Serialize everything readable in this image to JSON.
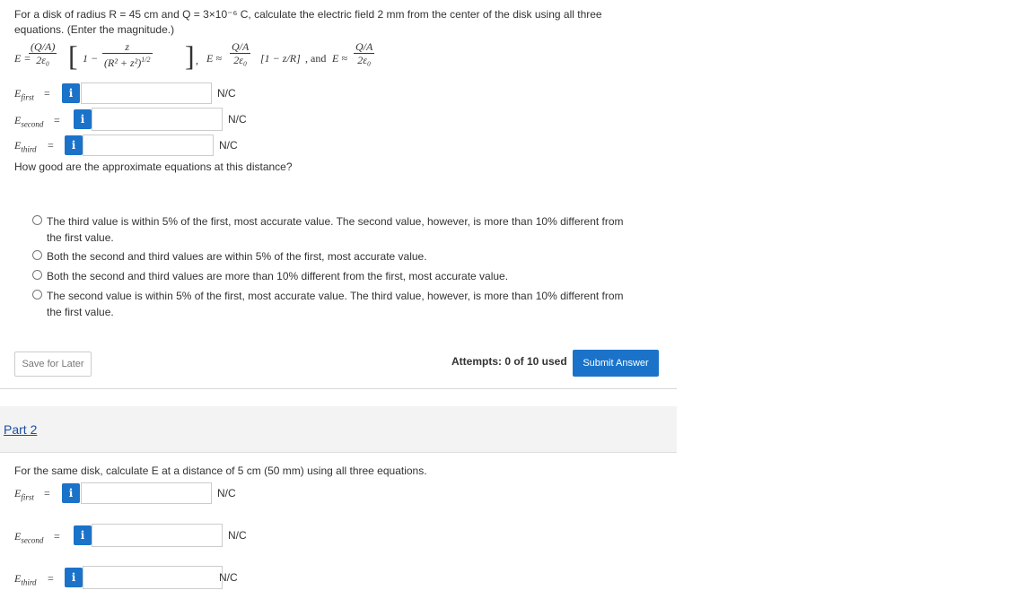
{
  "part1": {
    "question_line1": "For a disk of radius R = 45 cm and Q = 3×10⁻⁶ C, calculate the electric field 2 mm from the center of the disk using all three",
    "question_line2": "equations. (Enter the magnitude.)",
    "equations": {
      "exact": {
        "lhs": "E =",
        "coef_num": "(Q/A)",
        "coef_den": "2ε₀",
        "inner_num": "z",
        "inner_den": "(R² + z²)",
        "inner_exp": "1/2",
        "bracket_left": "1 −",
        "trailing": ","
      },
      "approx1": {
        "lhs": "E ≈",
        "coef_num": "Q/A",
        "coef_den": "2ε₀",
        "bracket": "[1 − z/R]",
        "trailing": ", and"
      },
      "approx2": {
        "lhs": "E ≈",
        "coef_num": "Q/A",
        "coef_den": "2ε₀"
      }
    },
    "answers": [
      {
        "label_main": "E",
        "label_sub": "first",
        "eq": "=",
        "info": "i",
        "value": "",
        "unit": "N/C"
      },
      {
        "label_main": "E",
        "label_sub": "second",
        "eq": "=",
        "info": "i",
        "value": "",
        "unit": "N/C"
      },
      {
        "label_main": "E",
        "label_sub": "third",
        "eq": "=",
        "info": "i",
        "value": "",
        "unit": "N/C"
      }
    ],
    "followup_question": "How good are the approximate equations at this distance?",
    "options": [
      "The third value is within 5% of the first, most accurate value. The second value, however, is more than 10% different from the first value.",
      "Both the second and third values are within 5% of the first, most accurate value.",
      "Both the second and third values are more than 10% different from the first, most accurate value.",
      "The second value is within 5% of the first, most accurate value. The third value, however, is more than 10% different from the first value."
    ],
    "save_label": "Save for Later",
    "attempts_text": "Attempts: 0 of 10 used",
    "submit_label": "Submit Answer"
  },
  "part2": {
    "title": "Part 2",
    "question": "For the same disk, calculate E at a distance of 5 cm (50 mm) using all three equations.",
    "answers": [
      {
        "label_main": "E",
        "label_sub": "first",
        "eq": "=",
        "info": "i",
        "value": "",
        "unit": "N/C"
      },
      {
        "label_main": "E",
        "label_sub": "second",
        "eq": "=",
        "info": "i",
        "value": "",
        "unit": "N/C"
      },
      {
        "label_main": "E",
        "label_sub": "third",
        "eq": "=",
        "info": "i",
        "value": "",
        "unit": "N/C"
      }
    ]
  },
  "colors": {
    "accent": "#1a73c9",
    "link": "#1a4fa0",
    "band": "#f3f3f3"
  }
}
